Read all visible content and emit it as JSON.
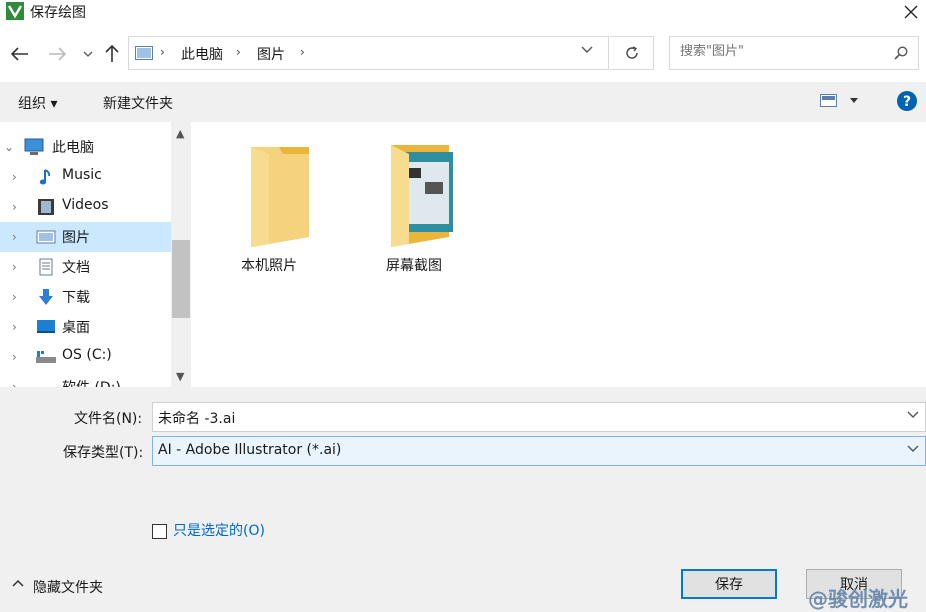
{
  "window": {
    "title": "保存绘图"
  },
  "address_bar": {
    "breadcrumbs": [
      "此电脑",
      "图片"
    ]
  },
  "search": {
    "placeholder": "搜索\"图片\""
  },
  "toolbar": {
    "organize_label": "组织 ▾",
    "new_folder_label": "新建文件夹"
  },
  "nav": {
    "items": [
      {
        "label": "此电脑",
        "icon": "computer-icon"
      },
      {
        "label": "Music",
        "icon": "music-icon"
      },
      {
        "label": "Videos",
        "icon": "video-icon"
      },
      {
        "label": "图片",
        "icon": "pictures-icon",
        "selected": true
      },
      {
        "label": "文档",
        "icon": "document-icon"
      },
      {
        "label": "下载",
        "icon": "download-icon"
      },
      {
        "label": "桌面",
        "icon": "desktop-icon"
      },
      {
        "label": "OS (C:)",
        "icon": "drive-icon"
      },
      {
        "label": "软件 (D:)",
        "icon": "drive-icon"
      }
    ]
  },
  "content": {
    "folders": [
      {
        "label": "本机照片"
      },
      {
        "label": "屏幕截图"
      }
    ]
  },
  "form": {
    "filename_label": "文件名(N):",
    "filename_value": "未命名 -3.ai",
    "filetype_label": "保存类型(T):",
    "filetype_value": "AI - Adobe Illustrator (*.ai)",
    "selected_only_label": "只是选定的(O)"
  },
  "footer": {
    "hide_folders_label": "隐藏文件夹",
    "save_label": "保存",
    "cancel_label": "取消",
    "watermark": "@骏创激光"
  },
  "colors": {
    "accent": "#0078d7",
    "selection": "#cce8ff",
    "help": "#0063b1"
  }
}
